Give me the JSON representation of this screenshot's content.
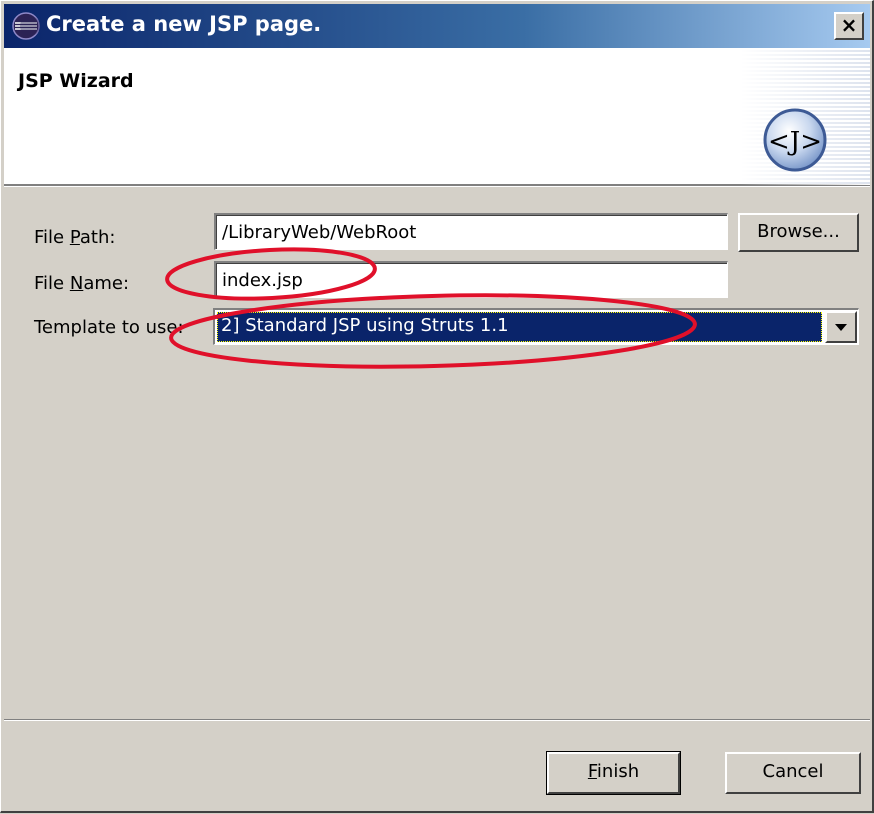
{
  "window": {
    "title": "Create a new JSP page.",
    "close_label": "×"
  },
  "header": {
    "title": "JSP Wizard",
    "logo_text": "<J>"
  },
  "form": {
    "file_path": {
      "label": "File Path:",
      "mnemonic": "P",
      "value": "/LibraryWeb/WebRoot"
    },
    "file_name": {
      "label": "File Name:",
      "mnemonic": "N",
      "value": "index.jsp"
    },
    "template": {
      "label": "Template to use:",
      "value": "2] Standard JSP using Struts 1.1"
    },
    "browse_label": "Browse..."
  },
  "buttons": {
    "finish_label": "Finish",
    "cancel_label": "Cancel"
  },
  "icons": {
    "title": "eclipse-icon",
    "wizard": "jsp-wizard-icon",
    "dropdown": "chevron-down-icon"
  },
  "colors": {
    "titlebar_start": "#0a246a",
    "titlebar_end": "#a6caf0",
    "dialog_bg": "#d4d0c8",
    "selection_bg": "#0a246a",
    "annotation_red": "#e0102a"
  }
}
